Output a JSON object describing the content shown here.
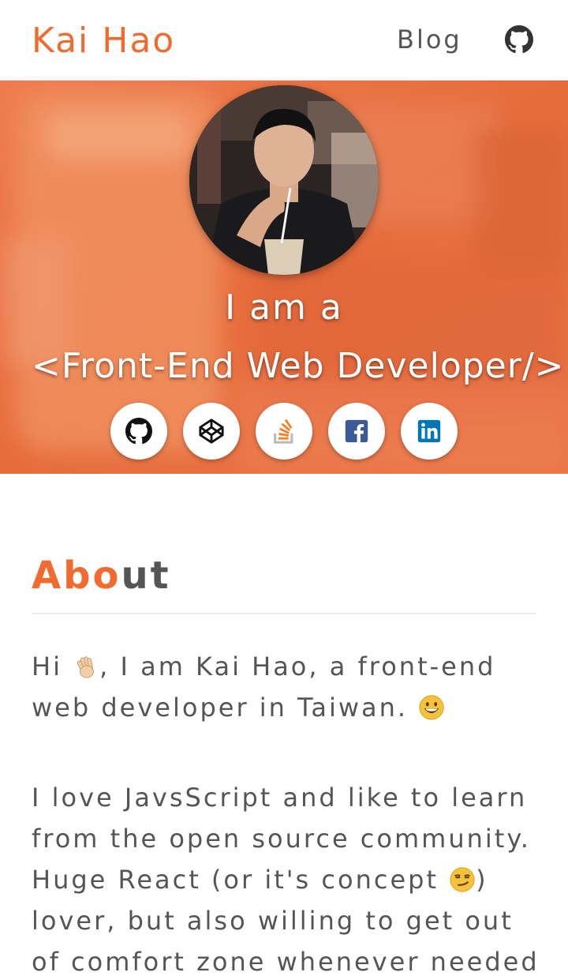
{
  "header": {
    "brand": "Kai Hao",
    "nav": {
      "blog_label": "Blog"
    },
    "github_icon": "github-icon"
  },
  "hero": {
    "intro_prefix": "I am a",
    "role": "<Front-End Web Developer/>",
    "social": [
      {
        "icon": "github-icon"
      },
      {
        "icon": "codepen-icon"
      },
      {
        "icon": "stackoverflow-icon"
      },
      {
        "icon": "facebook-icon"
      },
      {
        "icon": "linkedin-icon"
      }
    ]
  },
  "about": {
    "title_accent": "Abo",
    "title_rest": "ut",
    "p1_a": "Hi",
    "p1_b": ", I am Kai Hao, a front-end web developer in Taiwan.",
    "p2_a": "I love JavsScript and like to learn from the open source community. Huge React (or it's concept",
    "p2_b": ") lover, but also willing to get out of comfort zone whenever needed",
    "p2_c": "."
  },
  "colors": {
    "accent": "#f26a2e",
    "text": "#555555",
    "hero_tint": "#e9784a",
    "stackoverflow": "#f48024",
    "facebook": "#3b5998",
    "linkedin": "#0077b5"
  }
}
